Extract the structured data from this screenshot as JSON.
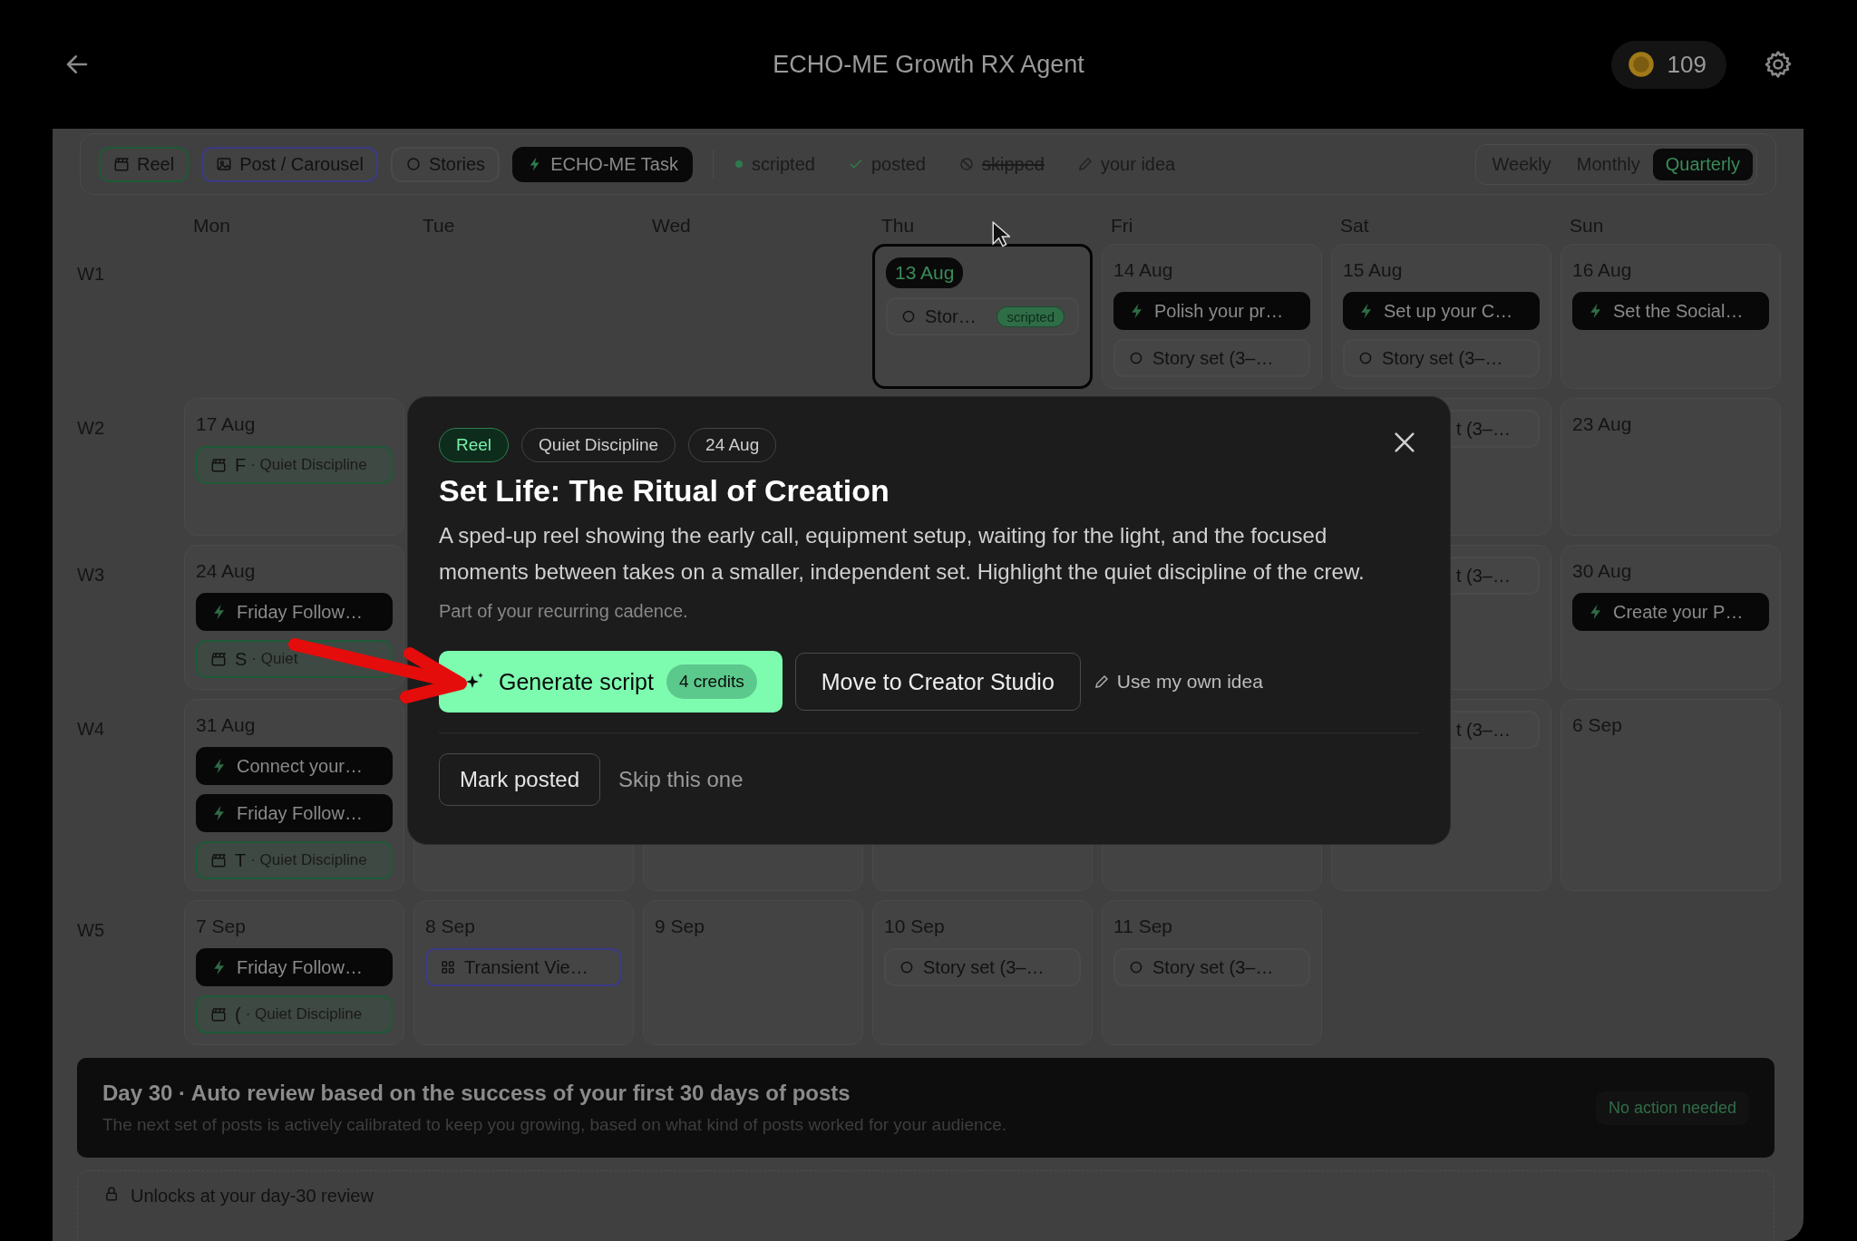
{
  "header": {
    "title": "ECHO-ME Growth RX Agent",
    "credits": "109"
  },
  "legend": {
    "types": [
      {
        "kind": "reel",
        "label": "Reel"
      },
      {
        "kind": "post",
        "label": "Post / Carousel"
      },
      {
        "kind": "story",
        "label": "Stories"
      },
      {
        "kind": "task",
        "label": "ECHO-ME Task"
      }
    ],
    "statuses": [
      {
        "kind": "scripted",
        "label": "scripted"
      },
      {
        "kind": "posted",
        "label": "posted"
      },
      {
        "kind": "skipped",
        "label": "skipped"
      },
      {
        "kind": "idea",
        "label": "your idea"
      }
    ]
  },
  "views": [
    {
      "label": "Weekly",
      "selected": false
    },
    {
      "label": "Monthly",
      "selected": false
    },
    {
      "label": "Quarterly",
      "selected": true
    }
  ],
  "day_headers": [
    "Mon",
    "Tue",
    "Wed",
    "Thu",
    "Fri",
    "Sat",
    "Sun"
  ],
  "weeks": [
    {
      "label": "W1",
      "days": [
        {
          "kind": "blank"
        },
        {
          "kind": "blank"
        },
        {
          "kind": "blank"
        },
        {
          "date": "13 Aug",
          "selected": true,
          "events": [
            {
              "kind": "story",
              "title": "Stor…",
              "status": "scripted"
            }
          ]
        },
        {
          "date": "14 Aug",
          "selected": false,
          "events": [
            {
              "kind": "task",
              "title": "Polish your pr…"
            },
            {
              "kind": "story",
              "title": "Story set (3–…"
            }
          ]
        },
        {
          "date": "15 Aug",
          "selected": false,
          "events": [
            {
              "kind": "task",
              "title": "Set up your C…"
            },
            {
              "kind": "story",
              "title": "Story set (3–…"
            }
          ]
        },
        {
          "date": "16 Aug",
          "selected": false,
          "events": [
            {
              "kind": "task",
              "title": "Set the Social…"
            }
          ]
        }
      ]
    },
    {
      "label": "W2",
      "days": [
        {
          "date": "17 Aug",
          "selected": false,
          "events": [
            {
              "kind": "reel",
              "title": "F",
              "series": "· Quiet Discipline"
            }
          ]
        },
        {
          "kind": "blank"
        },
        {
          "kind": "blank"
        },
        {
          "kind": "blank"
        },
        {
          "kind": "blank"
        },
        {
          "selected": false,
          "events": [
            {
              "kind": "story",
              "title": "t (3–…",
              "cut": true
            }
          ]
        },
        {
          "date": "23 Aug",
          "selected": false
        }
      ]
    },
    {
      "label": "W3",
      "days": [
        {
          "date": "24 Aug",
          "selected": false,
          "events": [
            {
              "kind": "task",
              "title": "Friday Follow…"
            },
            {
              "kind": "reel",
              "title": "S",
              "series": "· Quiet"
            }
          ]
        },
        {
          "kind": "blank"
        },
        {
          "kind": "blank"
        },
        {
          "kind": "blank"
        },
        {
          "kind": "blank"
        },
        {
          "selected": false,
          "events": [
            {
              "kind": "story",
              "title": "t (3–…",
              "cut": true
            }
          ]
        },
        {
          "date": "30 Aug",
          "selected": false,
          "events": [
            {
              "kind": "task",
              "title": "Create your P…"
            }
          ]
        }
      ]
    },
    {
      "label": "W4",
      "days": [
        {
          "date": "31 Aug",
          "selected": false,
          "events": [
            {
              "kind": "task",
              "title": "Connect your…"
            },
            {
              "kind": "task",
              "title": "Friday Follow…"
            },
            {
              "kind": "reel",
              "title": "T",
              "series": "· Quiet Discipline"
            }
          ]
        },
        {
          "selected": false
        },
        {
          "selected": false
        },
        {
          "selected": false
        },
        {
          "selected": false
        },
        {
          "selected": false,
          "events": [
            {
              "kind": "story",
              "title": "t (3–…",
              "cut": true
            }
          ]
        },
        {
          "date": "6 Sep",
          "selected": false
        }
      ]
    },
    {
      "label": "W5",
      "days": [
        {
          "date": "7 Sep",
          "selected": false,
          "events": [
            {
              "kind": "task",
              "title": "Friday Follow…"
            },
            {
              "kind": "reel",
              "title": "(",
              "series": "· Quiet Discipline"
            }
          ]
        },
        {
          "date": "8 Sep",
          "selected": false,
          "events": [
            {
              "kind": "post",
              "title": "Transient Vie…"
            }
          ]
        },
        {
          "date": "9 Sep",
          "selected": false
        },
        {
          "date": "10 Sep",
          "selected": false,
          "events": [
            {
              "kind": "story",
              "title": "Story set (3–…"
            }
          ]
        },
        {
          "date": "11 Sep",
          "selected": false,
          "events": [
            {
              "kind": "story",
              "title": "Story set (3–…"
            }
          ]
        },
        {
          "kind": "blank"
        },
        {
          "kind": "blank"
        }
      ]
    }
  ],
  "review": {
    "title": "Day 30 · Auto review based on the success of your first 30 days of posts",
    "text": "The next set of posts is actively calibrated to keep you growing, based on what kind of posts worked for your audience.",
    "badge": "No action needed"
  },
  "locked": {
    "text": "Unlocks at your day-30 review"
  },
  "modal": {
    "tags": [
      {
        "kind": "type",
        "label": "Reel"
      },
      {
        "kind": "plain",
        "label": "Quiet Discipline"
      },
      {
        "kind": "plain",
        "label": "24 Aug"
      }
    ],
    "title": "Set Life: The Ritual of Creation",
    "description": "A sped-up reel showing the early call, equipment setup, waiting for the light, and the focused moments between takes on a smaller, independent set. Highlight the quiet discipline of the crew.",
    "note": "Part of your recurring cadence.",
    "primary": {
      "label": "Generate script",
      "badge": "4 credits"
    },
    "secondary": "Move to Creator Studio",
    "link": "Use my own idea",
    "mark": "Mark posted",
    "skip": "Skip this one"
  }
}
